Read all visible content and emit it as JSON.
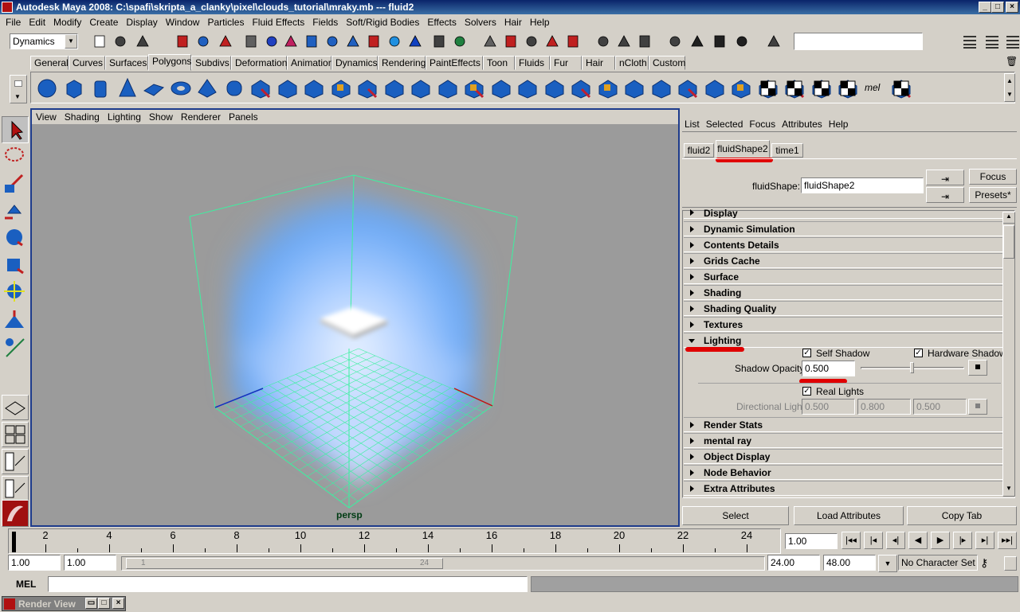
{
  "title": "Autodesk Maya 2008: C:\\spafi\\skripta_a_clanky\\pixel\\clouds_tutorial\\mraky.mb   ---   fluid2",
  "menu": [
    "File",
    "Edit",
    "Modify",
    "Create",
    "Display",
    "Window",
    "Particles",
    "Fluid Effects",
    "Fields",
    "Soft/Rigid Bodies",
    "Effects",
    "Solvers",
    "Hair",
    "Help"
  ],
  "mode_select": "Dynamics",
  "shelf_tabs": [
    "General",
    "Curves",
    "Surfaces",
    "Polygons",
    "Subdivs",
    "Deformation",
    "Animation",
    "Dynamics",
    "Rendering",
    "PaintEffects",
    "Toon",
    "Fluids",
    "Fur",
    "Hair",
    "nCloth",
    "Custom"
  ],
  "shelf_active": "Polygons",
  "viewport": {
    "menu": [
      "View",
      "Shading",
      "Lighting",
      "Show",
      "Renderer",
      "Panels"
    ],
    "camera": "persp"
  },
  "ae": {
    "menu": [
      "List",
      "Selected",
      "Focus",
      "Attributes",
      "Help"
    ],
    "tabs": [
      "fluid2",
      "fluidShape2",
      "time1"
    ],
    "active_tab": "fluidShape2",
    "node_label": "fluidShape:",
    "node_value": "fluidShape2",
    "focus_btn": "Focus",
    "presets_btn": "Presets*",
    "top_partial": "Display",
    "sections_before": [
      "Dynamic Simulation",
      "Contents Details",
      "Grids Cache",
      "Surface",
      "Shading",
      "Shading Quality",
      "Textures"
    ],
    "lighting": {
      "title": "Lighting",
      "self_shadow": "Self Shadow",
      "hardware_shadow": "Hardware Shadow",
      "shadow_opacity_label": "Shadow Opacity",
      "shadow_opacity": "0.500",
      "shadow_opacity_slider": 0.5,
      "real_lights": "Real Lights",
      "directional_light_label": "Directional Light",
      "dir_x": "0.500",
      "dir_y": "0.800",
      "dir_z": "0.500"
    },
    "sections_after": [
      "Render Stats",
      "mental ray",
      "Object Display",
      "Node Behavior",
      "Extra Attributes"
    ],
    "select_btn": "Select",
    "load_btn": "Load Attributes",
    "copy_btn": "Copy Tab"
  },
  "timeline": {
    "labels": [
      "2",
      "4",
      "6",
      "8",
      "10",
      "12",
      "14",
      "16",
      "18",
      "20",
      "22",
      "24"
    ],
    "current": "1.00"
  },
  "range": {
    "start": "1.00",
    "start2": "1.00",
    "slider_start": "1",
    "slider_end": "24",
    "end": "24.00",
    "end2": "48.00",
    "character": "No Character Set"
  },
  "mel": {
    "label": "MEL"
  },
  "render_view": "Render View",
  "colors": {
    "accent": "#0a246a",
    "viewport_border": "#1e3c8c",
    "grid": "#3cf0a0",
    "highlight": "#e00000"
  }
}
